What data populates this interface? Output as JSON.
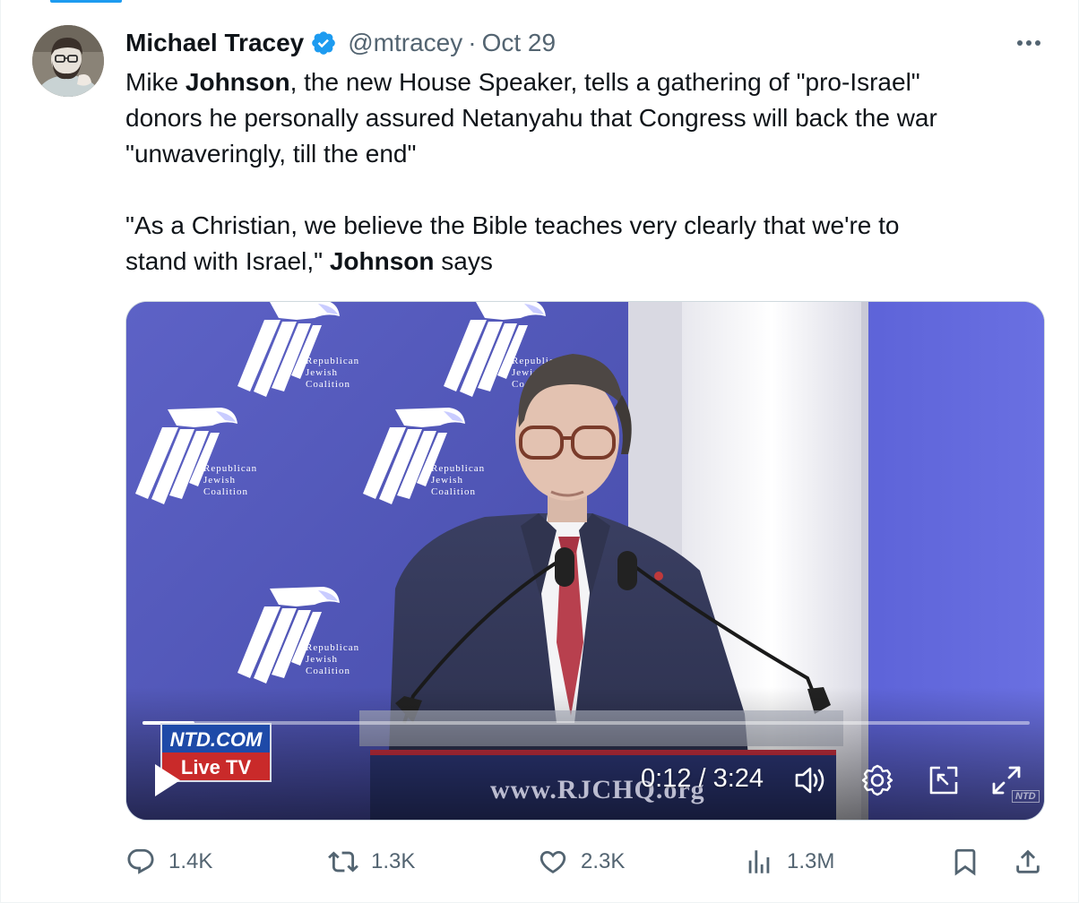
{
  "author": {
    "display_name": "Michael Tracey",
    "handle": "@mtracey",
    "separator": "·",
    "date": "Oct 29"
  },
  "tweet": {
    "lines": [
      [
        {
          "t": "Mike "
        },
        {
          "t": "Johnson",
          "b": true
        },
        {
          "t": ", the new House Speaker, tells a gathering of \"pro-Israel\""
        }
      ],
      [
        {
          "t": "donors he personally assured Netanyahu that Congress will back the war"
        }
      ],
      [
        {
          "t": "\"unwaveringly, till the end\""
        }
      ],
      [],
      [
        {
          "t": "\"As a Christian, we believe the Bible teaches very clearly that we're to"
        }
      ],
      [
        {
          "t": "stand with Israel,\" "
        },
        {
          "t": "Johnson",
          "b": true
        },
        {
          "t": " says"
        }
      ]
    ]
  },
  "video": {
    "current_time": "0:12",
    "duration": "3:24",
    "time_display": "0:12 / 3:24",
    "progress_fraction": 0.059,
    "backdrop_org": "REPUBLICAN JEWISH COALITION",
    "backdrop_lines": [
      "Republican",
      "Jewish",
      "Coalition"
    ],
    "podium_url": "www.RJCHQ.org",
    "ntd_top": "NTD.COM",
    "ntd_bottom": "Live TV",
    "ntd_watermark": "NTD",
    "icons": [
      "play-icon",
      "volume-icon",
      "settings-icon",
      "dock-icon",
      "fullscreen-icon"
    ]
  },
  "actions": {
    "replies": "1.4K",
    "reposts": "1.3K",
    "likes": "2.3K",
    "views": "1.3M"
  },
  "colors": {
    "accent": "#1d9bf0",
    "text": "#0f1419",
    "secondary": "#536471"
  }
}
